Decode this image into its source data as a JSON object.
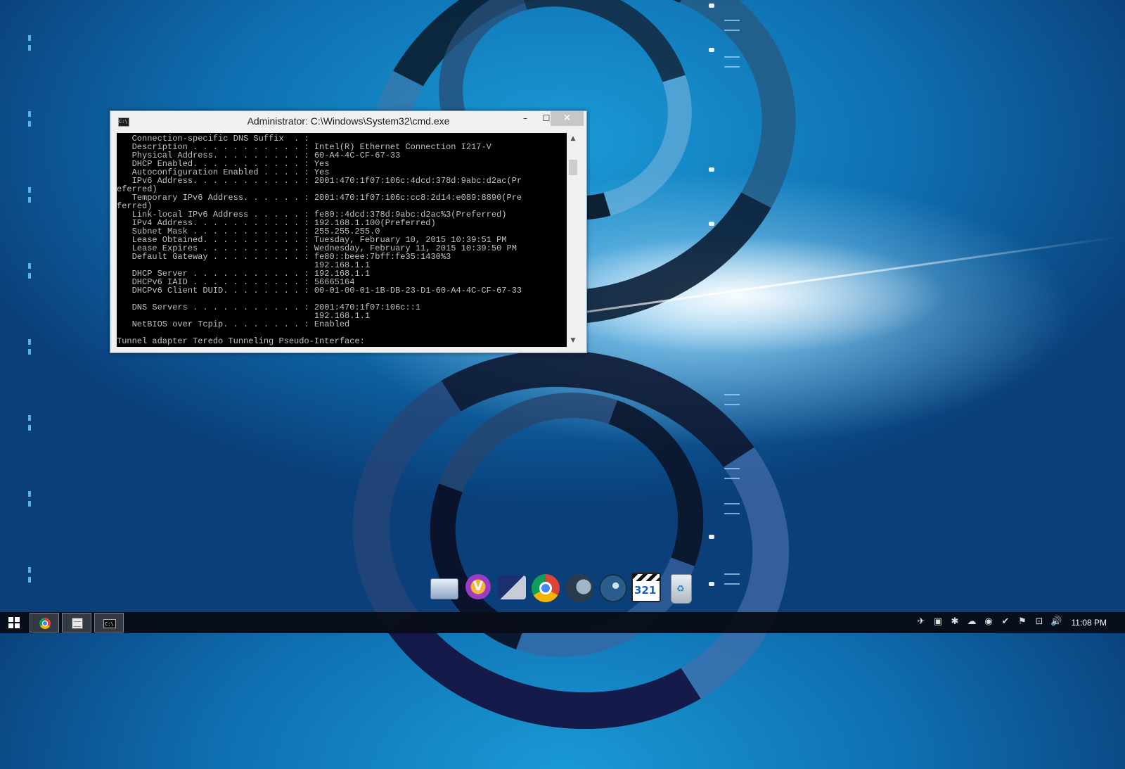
{
  "window": {
    "title": "Administrator: C:\\Windows\\System32\\cmd.exe",
    "icon_label": "C:\\",
    "minimize": "–",
    "maximize": "☐",
    "close": "✕",
    "console_lines": [
      "   Connection-specific DNS Suffix  . :",
      "   Description . . . . . . . . . . . : Intel(R) Ethernet Connection I217-V",
      "   Physical Address. . . . . . . . . : 60-A4-4C-CF-67-33",
      "   DHCP Enabled. . . . . . . . . . . : Yes",
      "   Autoconfiguration Enabled . . . . : Yes",
      "   IPv6 Address. . . . . . . . . . . : 2001:470:1f07:106c:4dcd:378d:9abc:d2ac(Pr",
      "eferred)",
      "   Temporary IPv6 Address. . . . . . : 2001:470:1f07:106c:cc8:2d14:e089:8890(Pre",
      "ferred)",
      "   Link-local IPv6 Address . . . . . : fe80::4dcd:378d:9abc:d2ac%3(Preferred)",
      "   IPv4 Address. . . . . . . . . . . : 192.168.1.100(Preferred)",
      "   Subnet Mask . . . . . . . . . . . : 255.255.255.0",
      "   Lease Obtained. . . . . . . . . . : Tuesday, February 10, 2015 10:39:51 PM",
      "   Lease Expires . . . . . . . . . . : Wednesday, February 11, 2015 10:39:50 PM",
      "   Default Gateway . . . . . . . . . : fe80::beee:7bff:fe35:1430%3",
      "                                       192.168.1.1",
      "   DHCP Server . . . . . . . . . . . : 192.168.1.1",
      "   DHCPv6 IAID . . . . . . . . . . . : 56665164",
      "   DHCPv6 Client DUID. . . . . . . . : 00-01-00-01-1B-DB-23-D1-60-A4-4C-CF-67-33",
      "",
      "   DNS Servers . . . . . . . . . . . : 2001:470:1f07:106c::1",
      "                                       192.168.1.1",
      "   NetBIOS over Tcpip. . . . . . . . : Enabled",
      "",
      "Tunnel adapter Teredo Tunneling Pseudo-Interface:"
    ],
    "scroll_up": "▲",
    "scroll_down": "▼"
  },
  "dock": {
    "items": [
      {
        "name": "file-explorer",
        "icon": "folder-icon"
      },
      {
        "name": "v-app",
        "icon": "v-badge-icon",
        "glyph": "V"
      },
      {
        "name": "tool-app",
        "icon": "tool-icon"
      },
      {
        "name": "chrome",
        "icon": "chrome-icon"
      },
      {
        "name": "moon-app",
        "icon": "moon-icon"
      },
      {
        "name": "steam",
        "icon": "steam-icon"
      },
      {
        "name": "media-player",
        "icon": "clapperboard-icon",
        "glyph": "321"
      },
      {
        "name": "recycle-bin",
        "icon": "recycle-bin-icon",
        "glyph": "♻"
      }
    ]
  },
  "taskbar": {
    "start_icon": "windows-logo-icon",
    "buttons": [
      {
        "name": "chrome",
        "icon": "chrome-icon"
      },
      {
        "name": "document",
        "icon": "document-icon"
      },
      {
        "name": "cmd",
        "icon": "cmd-icon",
        "glyph": "C:\\"
      }
    ],
    "tray_icons": [
      {
        "name": "plane-icon",
        "glyph": "✈"
      },
      {
        "name": "monitor-icon",
        "glyph": "▣"
      },
      {
        "name": "network-activity-icon",
        "glyph": "✱"
      },
      {
        "name": "cloud-icon",
        "glyph": "☁"
      },
      {
        "name": "chrome-tray-icon",
        "glyph": "◉"
      },
      {
        "name": "security-icon",
        "glyph": "✔"
      },
      {
        "name": "action-center-flag-icon",
        "glyph": "⚑"
      },
      {
        "name": "network-icon",
        "glyph": "⊡"
      },
      {
        "name": "volume-icon",
        "glyph": "🔊"
      }
    ],
    "clock": "11:08 PM"
  },
  "colors": {
    "console_bg": "#000000",
    "console_text": "#c0c0c0",
    "close_button": "#c7c7c7",
    "taskbar": "#080e18"
  }
}
